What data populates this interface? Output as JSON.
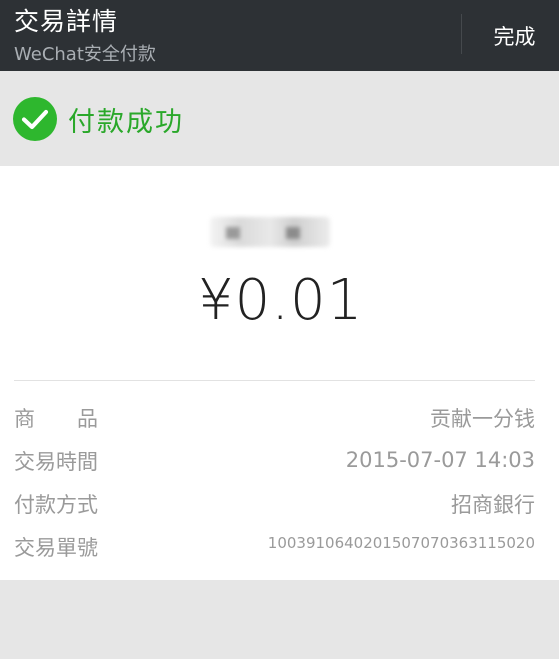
{
  "header": {
    "title": "交易詳情",
    "subtitle": "WeChat安全付款",
    "done_label": "完成"
  },
  "status": {
    "text": "付款成功",
    "icon": "check-circle-icon",
    "color": "#2eb72e"
  },
  "payment": {
    "amount": "¥0.01"
  },
  "details": {
    "rows": [
      {
        "label": "商　　品",
        "value": "贡献一分钱"
      },
      {
        "label": "交易時間",
        "value": "2015-07-07 14:03"
      },
      {
        "label": "付款方式",
        "value": "招商銀行"
      },
      {
        "label": "交易單號",
        "value": "1003910640201507070363115020"
      }
    ]
  },
  "colors": {
    "header_bg": "#2d3135",
    "accent_green": "#2eb72e",
    "page_bg": "#e6e6e6"
  }
}
